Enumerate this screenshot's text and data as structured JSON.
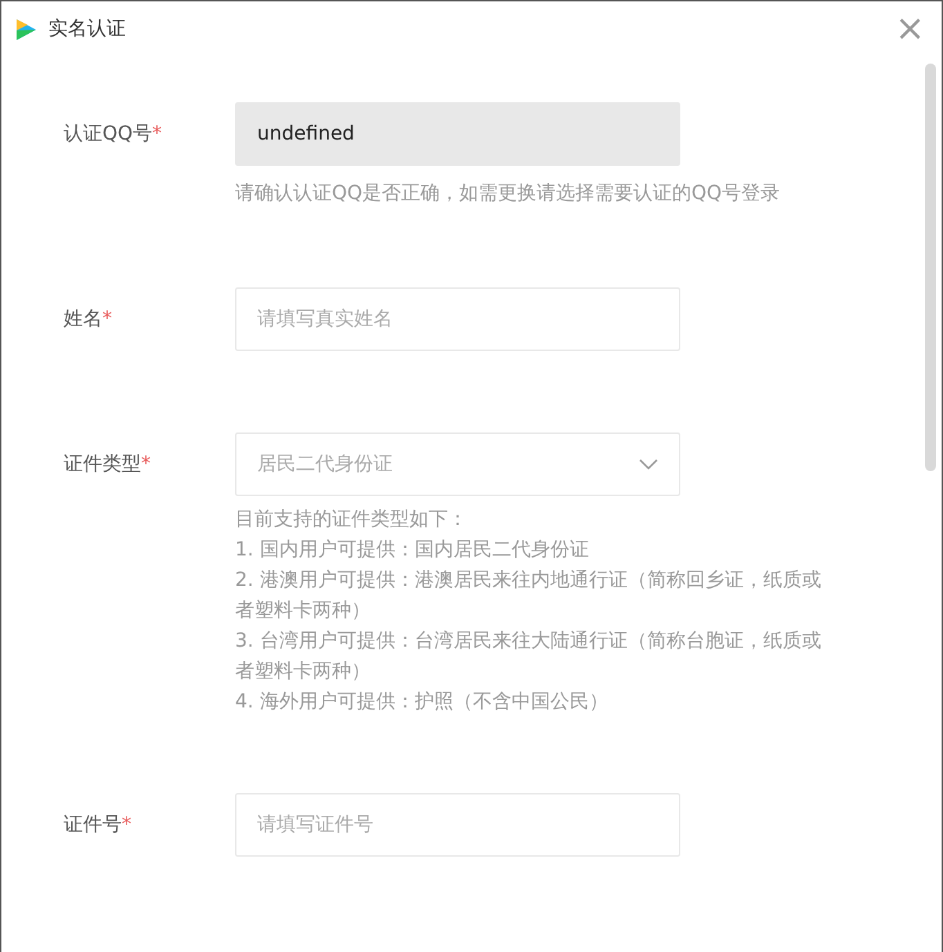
{
  "window": {
    "title": "实名认证",
    "close": "×"
  },
  "fields": [
    {
      "label": "认证QQ号",
      "required_mark": "*",
      "kind": "readonly",
      "value": "undefined",
      "hint": "请确认认证QQ是否正确，如需更换请选择需要认证的QQ号登录"
    },
    {
      "label": "姓名",
      "required_mark": "*",
      "kind": "text",
      "placeholder": "请填写真实姓名"
    },
    {
      "label": "证件类型",
      "required_mark": "*",
      "kind": "select",
      "placeholder": "居民二代身份证",
      "notes": [
        "目前支持的证件类型如下：",
        "1. 国内用户可提供：国内居民二代身份证",
        "2. 港澳用户可提供：港澳居民来往内地通行证（简称回乡证，纸质或者塑料卡两种）",
        "3. 台湾用户可提供：台湾居民来往大陆通行证（简称台胞证，纸质或者塑料卡两种）",
        "4. 海外用户可提供：护照（不含中国公民）"
      ]
    },
    {
      "label": "证件号",
      "required_mark": "*",
      "kind": "text",
      "placeholder": "请填写证件号"
    }
  ]
}
